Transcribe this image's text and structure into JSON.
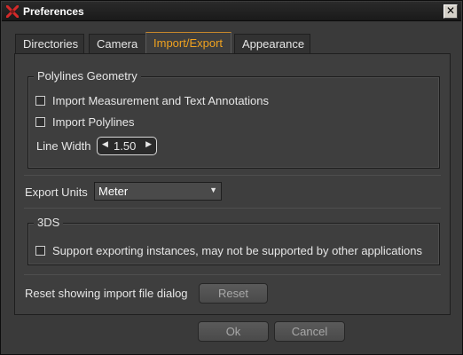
{
  "window": {
    "title": "Preferences",
    "close_glyph": "✕"
  },
  "tabs": [
    {
      "label": "Directories"
    },
    {
      "label": "Camera"
    },
    {
      "label": "Import/Export",
      "active": true
    },
    {
      "label": "Appearance"
    }
  ],
  "polylines": {
    "title": "Polylines Geometry",
    "import_annotations_label": "Import Measurement and Text Annotations",
    "import_polylines_label": "Import Polylines",
    "line_width_label": "Line Width",
    "line_width_value": "1.50"
  },
  "export_units": {
    "label": "Export Units",
    "value": "Meter"
  },
  "three_ds": {
    "title": "3DS",
    "support_instances_label": "Support exporting instances, may not be supported by other applications"
  },
  "reset": {
    "label": "Reset showing import file dialog",
    "button": "Reset"
  },
  "footer": {
    "ok": "Ok",
    "cancel": "Cancel"
  },
  "colors": {
    "accent": "#f0a21f",
    "logo": "#d42a2a"
  },
  "icons": {
    "logo": "app-logo-icon",
    "close": "close-icon",
    "spin_left": "triangle-left-icon",
    "spin_right": "triangle-right-icon",
    "dropdown": "chevron-down-icon"
  }
}
